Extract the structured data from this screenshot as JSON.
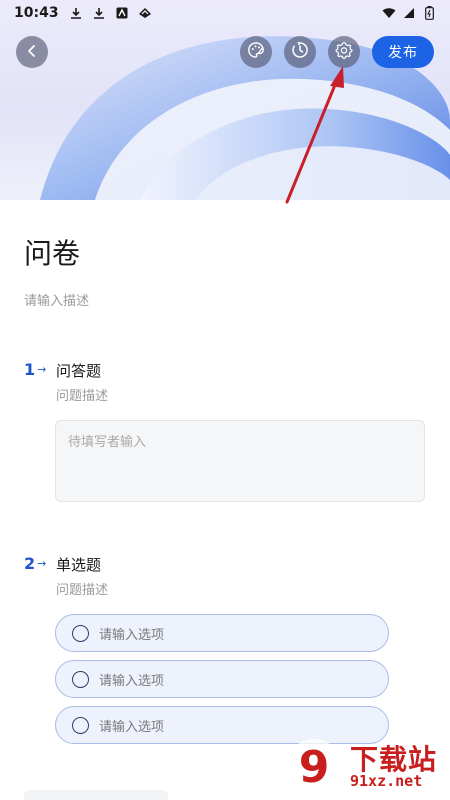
{
  "status_bar": {
    "time": "10:43",
    "icons": [
      "download-icon",
      "download-icon",
      "app-icon",
      "cloud-icon"
    ],
    "right_icons": [
      "wifi-icon",
      "signal-icon",
      "battery-icon"
    ]
  },
  "toolbar": {
    "back_icon": "chevron-left-icon",
    "palette_icon": "palette-icon",
    "timer_icon": "timer-icon",
    "settings_icon": "gear-icon",
    "publish_label": "发布"
  },
  "form": {
    "title": "问卷",
    "description_placeholder": "请输入描述"
  },
  "questions": [
    {
      "number": "1",
      "title": "问答题",
      "description": "问题描述",
      "answer_placeholder": "待填写者输入"
    },
    {
      "number": "2",
      "title": "单选题",
      "description": "问题描述",
      "options": [
        "请输入选项",
        "请输入选项",
        "请输入选项"
      ]
    }
  ],
  "watermark": {
    "logo_mark": "9",
    "text": "下载站",
    "sub": "91xz.net"
  },
  "colors": {
    "accent": "#1d63e6",
    "question_number": "#1d55c9",
    "annotation_arrow": "#c8202a"
  }
}
